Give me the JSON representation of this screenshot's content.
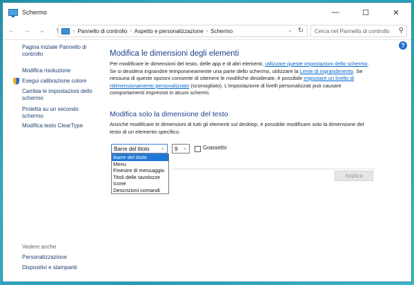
{
  "window": {
    "title": "Schermo",
    "controls": {
      "minimize": "—",
      "maximize": "☐",
      "close": "✕"
    }
  },
  "address": {
    "back": "←",
    "forward": "→",
    "recent": "⌄",
    "up": "↑",
    "breadcrumb": [
      "Pannello di controllo",
      "Aspetto e personalizzazione",
      "Schermo"
    ],
    "separator": "›",
    "dropdown": "⌄",
    "refresh": "↻"
  },
  "search": {
    "placeholder": "Cerca nel Pannello di controllo",
    "icon": "⚲"
  },
  "help": "?",
  "sidebar": {
    "home": "Pagina iniziale Pannello di controllo",
    "items": [
      "Modifica risoluzione",
      "Esegui calibrazione colore",
      "Cambia le impostazioni dello schermo",
      "Proietta su un secondo schermo",
      "Modifica testo ClearType"
    ],
    "see_also_title": "Vedere anche",
    "see_also": [
      "Personalizzazione",
      "Dispositivi e stampanti"
    ]
  },
  "main": {
    "heading1": "Modifica le dimensioni degli elementi",
    "para1_part1": "Per modificare le dimensioni del testo, delle app e di altri elementi, ",
    "para1_link1": "utilizzare queste impostazioni dello schermo",
    "para1_part2": ". Se si desidera ingrandire temporaneamente una parte dello schermo, utilizzare la ",
    "para1_link2": "Lente di ingrandimento",
    "para1_part3": ". Se nessuna di queste opzioni consente di ottenere le modifiche desiderate, è possibile ",
    "para1_link3": "impostare un livello di ridimensionamento personalizzato",
    "para1_part4": " (sconsigliato). L'impostazione di livelli personalizzati può causare comportamenti imprevisti in alcuni schermi.",
    "heading2": "Modifica solo la dimensione del testo",
    "para2": "Anziché modificare le dimensioni di tutti gli elementi sul desktop, è possibile modificare solo la dimensione del testo di un elemento specifico.",
    "element_select_value": "Barre del titolo",
    "size_select_value": "9",
    "select_arrow": "⌄",
    "bold_label": "Grassetto",
    "apply_label": "Applica",
    "dropdown_options": [
      "Barre del titolo",
      "Menu",
      "Finestre di messaggio",
      "Titoli delle tavolozze",
      "Icone",
      "Descrizioni comandi"
    ]
  }
}
